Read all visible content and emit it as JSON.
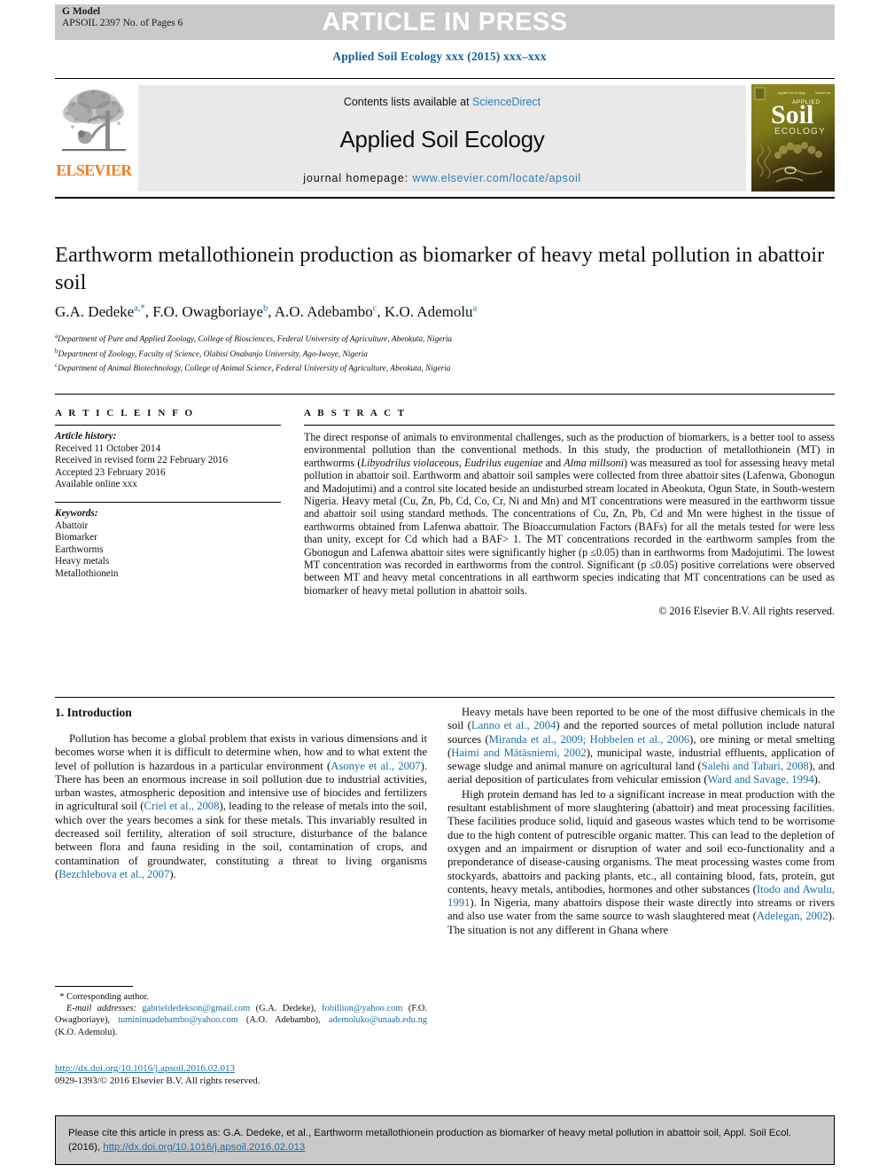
{
  "header": {
    "g_model": "G Model",
    "article_id": "APSOIL 2397 No. of Pages 6",
    "press_banner": "ARTICLE IN PRESS",
    "journal_reference": "Applied Soil Ecology xxx (2015) xxx–xxx"
  },
  "masthead": {
    "contents_prefix": "Contents lists available at ",
    "sciencedirect": "ScienceDirect",
    "journal_title": "Applied Soil Ecology",
    "homepage_prefix": "journal homepage: ",
    "homepage_url": "www.elsevier.com/locate/apsoil",
    "publisher": "ELSEVIER",
    "cover_line1": "Applied",
    "cover_line2": "Soil",
    "cover_line3": "ECOLOGY"
  },
  "article": {
    "title": "Earthworm metallothionein production as biomarker of heavy metal pollution in abattoir soil",
    "authors": [
      {
        "name": "G.A. Dedeke",
        "sup": "a,*"
      },
      {
        "name": "F.O. Owagboriaye",
        "sup": "b"
      },
      {
        "name": "A.O. Adebambo",
        "sup": "c"
      },
      {
        "name": "K.O. Ademolu",
        "sup": "a"
      }
    ],
    "affiliations": [
      {
        "marker": "a",
        "text": "Department of Pure and Applied Zoology, College of Biosciences, Federal University of Agriculture, Abeokuta, Nigeria"
      },
      {
        "marker": "b",
        "text": "Department of Zoology, Faculty of Science, Olabisi Onabanjo University, Ago-Iwoye, Nigeria"
      },
      {
        "marker": "c",
        "text": "Department of Animal Biotechnology, College of Animal Science, Federal University of Agriculture, Abeokuta, Nigeria"
      }
    ]
  },
  "article_info": {
    "heading": "A R T I C L E   I N F O",
    "history_label": "Article history:",
    "history": [
      "Received 11 October 2014",
      "Received in revised form 22 February 2016",
      "Accepted 23 February 2016",
      "Available online xxx"
    ],
    "keywords_label": "Keywords:",
    "keywords": [
      "Abattoir",
      "Biomarker",
      "Earthworms",
      "Heavy metals",
      "Metallothionein"
    ]
  },
  "abstract": {
    "heading": "A B S T R A C T",
    "copyright": "© 2016 Elsevier B.V. All rights reserved.",
    "paragraph_parts": {
      "p1": "The direct response of animals to environmental challenges, such as the production of biomarkers, is a better tool to assess environmental pollution than the conventional methods. In this study, the production of metallothionein (MT) in earthworms (",
      "species1": "Libyodrilus violaceous, Eudrilus eugeniae",
      "p2": " and ",
      "species2": "Alma millsoni",
      "p3": ") was measured as tool for assessing heavy metal pollution in abattoir soil. Earthworm and abattoir soil samples were collected from three abattoir sites (Lafenwa, Gbonogun and Madojutimi) and a control site located beside an undisturbed stream located in Abeokuta, Ogun State, in South-western Nigeria. Heavy metal (Cu, Zn, Pb, Cd, Co, Cr, Ni and Mn) and MT concentrations were measured in the earthworm tissue and abattoir soil using standard methods. The concentrations of Cu, Zn, Pb, Cd and Mn were highest in the tissue of earthworms obtained from Lafenwa abattoir. The Bioaccumulation Factors (BAFs) for all the metals tested for were less than unity, except for Cd which had a BAF> 1. The MT concentrations recorded in the earthworm samples from the Gbonogun and Lafenwa abattoir sites were significantly higher (p ≤0.05) than in earthworms from Madojutimi. The lowest MT concentration was recorded in earthworms from the control. Significant (p ≤0.05) positive correlations were observed between MT and heavy metal concentrations in all earthworm species indicating that MT concentrations can be used as biomarker of heavy metal pollution in abattoir soils."
    }
  },
  "introduction": {
    "heading": "1. Introduction",
    "left_paragraph": {
      "t1": "Pollution has become a global problem that exists in various dimensions and it becomes worse when it is difficult to determine when, how and to what extent the level of pollution is hazardous in a particular environment (",
      "c1": "Asonye et al., 2007",
      "t2": "). There has been an enormous increase in soil pollution due to industrial activities, urban wastes, atmospheric deposition and intensive use of biocides and fertilizers in agricultural soil (",
      "c2": "Criel et al., 2008",
      "t3": "), leading to the release of metals into the soil, which over the years becomes a sink for these metals. This invariably resulted in decreased soil fertility, alteration of soil structure, disturbance of the balance between flora and fauna residing in the soil, contamination of crops, and contamination of groundwater, constituting a threat to living organisms (",
      "c3": "Bezchlebova et al., 2007",
      "t4": ")."
    },
    "right_paragraph_1": {
      "t1": "Heavy metals have been reported to be one of the most diffusive chemicals in the soil (",
      "c1": "Lanno et al., 2004",
      "t2": ") and the reported sources of metal pollution include natural sources (",
      "c2": "Miranda et al., 2009; Hobbelen et al., 2006",
      "t3": "), ore mining or metal smelting (",
      "c3": "Haimi and Mätäsniemi, 2002",
      "t4": "), municipal waste, industrial effluents, application of sewage sludge and animal manure on agricultural land (",
      "c4": "Salehi and Tabari, 2008",
      "t5": "), and aerial deposition of particulates from vehicular emission (",
      "c5": "Ward and Savage, 1994",
      "t6": ")."
    },
    "right_paragraph_2": {
      "t1": "High protein demand has led to a significant increase in meat production with the resultant establishment of more slaughtering (abattoir) and meat processing facilities. These facilities produce solid, liquid and gaseous wastes which tend to be worrisome due to the high content of putrescible organic matter. This can lead to the depletion of oxygen and an impairment or disruption of water and soil eco-functionality and a preponderance of disease-causing organisms. The meat processing wastes come from stockyards, abattoirs and packing plants, etc., all containing blood, fats, protein, gut contents, heavy metals, antibodies, hormones and other substances (",
      "c1": "Itodo and Awulu, 1991",
      "t2": "). In Nigeria, many abattoirs dispose their waste directly into streams or rivers and also use water from the same source to wash slaughtered meat (",
      "c2": "Adelegan, 2002",
      "t3": "). The situation is not any different in Ghana where"
    }
  },
  "footnote": {
    "corresponding_marker": "*",
    "corresponding_author": "Corresponding author.",
    "email_label": "E-mail addresses:",
    "emails": [
      {
        "address": "gabrieldedekson@gmail.com",
        "owner": "(G.A. Dedeke),"
      },
      {
        "address": "fobillion@yahoo.com",
        "owner": "(F.O. Owagboriaye),"
      },
      {
        "address": "tumininuadebambo@yahoo.com",
        "owner": "(A.O. Adebambo),"
      },
      {
        "address": "ademoluko@unaab.edu.ng",
        "owner": "(K.O. Ademolu)."
      }
    ]
  },
  "doi_block": {
    "doi_url": "http://dx.doi.org/10.1016/j.apsoil.2016.02.013",
    "issn_line": "0929-1393/© 2016 Elsevier B.V. All rights reserved."
  },
  "citation_footer": {
    "text_part1": "Please cite this article in press as: G.A. Dedeke, et al., Earthworm metallothionein production as biomarker of heavy metal pollution in abattoir soil, Appl. Soil Ecol. (2016), ",
    "doi_url": "http://dx.doi.org/10.1016/j.apsoil.2016.02.013"
  },
  "colors": {
    "link_blue": "#1a6fa8",
    "sciencedirect_blue": "#2e7fbd",
    "elsevier_orange": "#f07d20",
    "band_gray": "#c9c9c9",
    "contents_gray": "#e9e9e9",
    "cover_olive": "#7e7a1c"
  }
}
